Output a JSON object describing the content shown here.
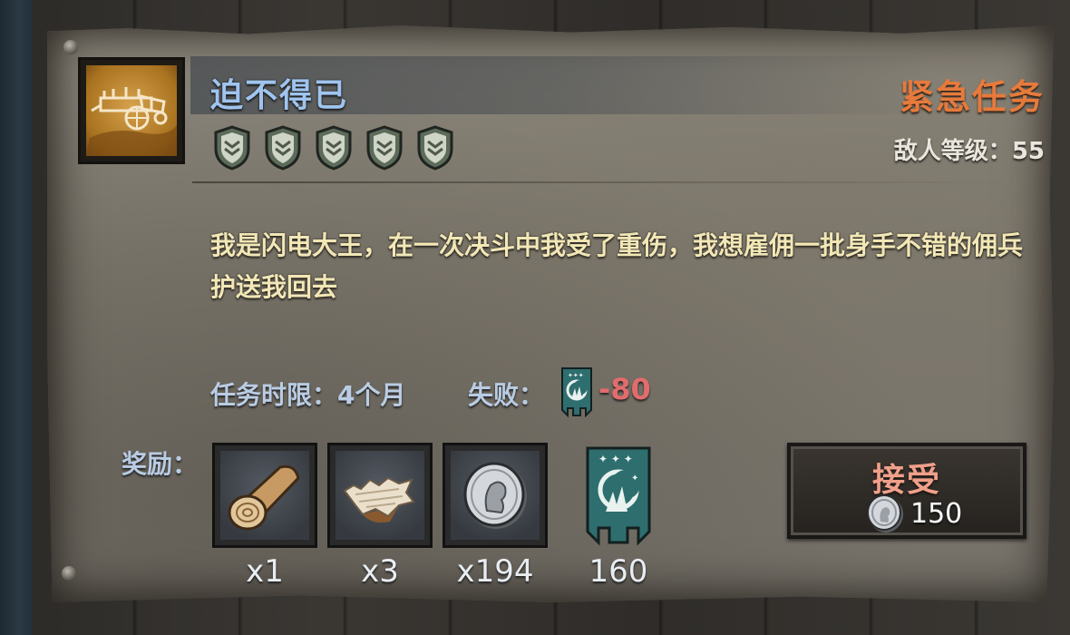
{
  "quest": {
    "title": "迫不得已",
    "type_label": "紧急任务",
    "enemy_level_label": "敌人等级：",
    "enemy_level": "55",
    "difficulty_shields": 5,
    "description": "我是闪电大王，在一次决斗中我受了重伤，我想雇佣一批身手不错的佣兵护送我回去",
    "deadline_label": "任务时限：",
    "deadline_value": "4个月",
    "fail_label": "失败：",
    "fail_value": "-80",
    "reward_label": "奖励："
  },
  "rewards": [
    {
      "icon": "wood-log-icon",
      "count": "x1"
    },
    {
      "icon": "hemp-fiber-icon",
      "count": "x3"
    },
    {
      "icon": "silver-coin-icon",
      "count": "x194"
    },
    {
      "icon": "faction-banner-icon",
      "count": "160"
    }
  ],
  "accept_button": {
    "label": "接受",
    "cost": "150",
    "cost_icon": "silver-coin-icon"
  },
  "colors": {
    "title": "#9fc4ef",
    "urgent": "#e67a3c",
    "description": "#f2e7b6",
    "fail_value": "#e26c6c",
    "accept_label": "#f0a08a",
    "banner_teal": "#2e6e6f"
  }
}
